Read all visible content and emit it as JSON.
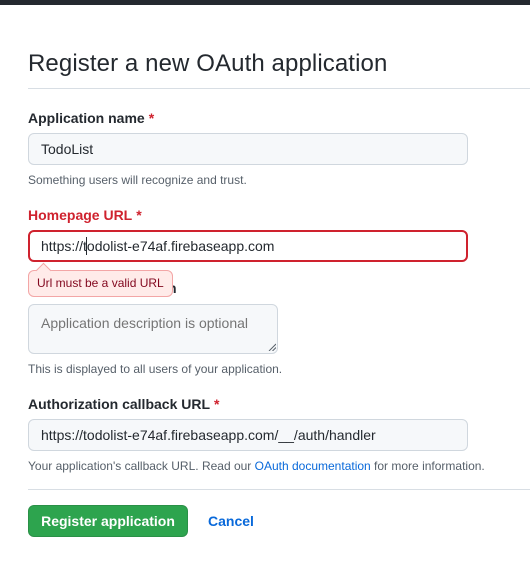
{
  "page": {
    "title": "Register a new OAuth application"
  },
  "form": {
    "app_name": {
      "label": "Application name",
      "required_mark": "*",
      "value": "TodoList",
      "note": "Something users will recognize and trust."
    },
    "homepage_url": {
      "label": "Homepage URL",
      "required_mark": "*",
      "value": "https://todolist-e74af.firebaseapp.com",
      "error_tooltip": "Url must be a valid URL"
    },
    "description": {
      "label_tail": "n",
      "placeholder": "Application description is optional",
      "note": "This is displayed to all users of your application."
    },
    "callback_url": {
      "label": "Authorization callback URL",
      "required_mark": "*",
      "value": "https://todolist-e74af.firebaseapp.com/__/auth/handler",
      "note_prefix": "Your application's callback URL. Read our ",
      "note_link": "OAuth documentation",
      "note_suffix": " for more information."
    }
  },
  "actions": {
    "register_label": "Register application",
    "cancel_label": "Cancel"
  },
  "colors": {
    "primary_button": "#2da44e",
    "error": "#cf222e",
    "link": "#0969da"
  }
}
